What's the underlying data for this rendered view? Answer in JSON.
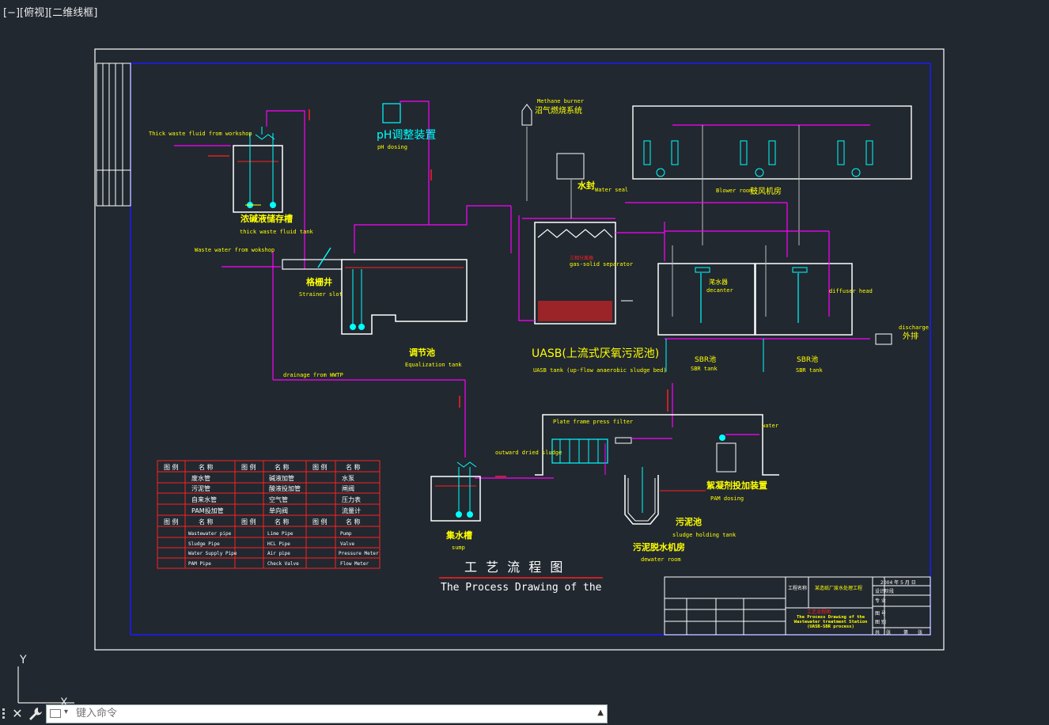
{
  "viewport": {
    "label": "[−][俯视][二维线框]"
  },
  "colors": {
    "background": "#212830",
    "frame": "#ffffff",
    "border": "#1a1aff",
    "pipe": "#ff00ff",
    "red": "#ff2020",
    "cyan": "#00ffff",
    "yellow": "#ffff00",
    "green": "#00ff00",
    "grey": "#bdbdbd"
  },
  "drawing": {
    "labels": {
      "thick_fluid_from_workshop": "Thick waste fluid from workshop",
      "thick_tank_cn": "浓碱液储存槽",
      "thick_tank_en": "thick waste fluid tank",
      "waste_water_from_workshop": "Waste water from wokshop",
      "strainer_cn": "格栅井",
      "strainer_en": "Strainer slot",
      "ph_cn": "pH调整装置",
      "ph_en": "pH dosing",
      "methane_en": "Methane burner",
      "methane_cn": "沼气燃烧系统",
      "water_seal_cn": "水封",
      "water_seal_en": "Water seal",
      "gas_solid_cn": "三相分离器",
      "gas_solid_en": "gas-solid separator",
      "blower_en": "Blower room",
      "blower_cn": "鼓风机房",
      "decanter_cn": "滗水器",
      "decanter_en": "decanter",
      "diffuser_en": "diffuser head",
      "discharge_en": "discharge",
      "discharge_cn": "外排",
      "equalization_cn": "调节池",
      "equalization_en": "Equalization tank",
      "uasb_cn": "UASB(上流式厌氧污泥池)",
      "uasb_en": "UASB tank (up-flow anaerobic sludge bed)",
      "sbr1_cn": "SBR池",
      "sbr1_en": "SBR tank",
      "sbr2_cn": "SBR池",
      "sbr2_en": "SBR tank",
      "drainage_en": "drainage from WWTP",
      "plate_frame_en": "Plate frame press filter",
      "outward_sludge_en": "outward dried sludge",
      "water_en": "water",
      "pam_cn": "絮凝剂投加装置",
      "pam_en": "PAM dosing",
      "sludge_tank_cn": "污泥池",
      "sludge_tank_en": "sludge holding tank",
      "dewater_cn": "污泥脱水机房",
      "dewater_en": "dewater room",
      "sump_cn": "集水槽",
      "sump_en": "sump",
      "title_cn": "工 艺 流 程 图",
      "title_en": "The Process Drawing of the"
    },
    "legend": {
      "header_cn": [
        "图 例",
        "名 称",
        "图 例",
        "名 称",
        "图 例",
        "名 称"
      ],
      "rows_cn": [
        [
          "废水管",
          "碱液加管",
          "水泵"
        ],
        [
          "污泥管",
          "酸液投加管",
          "闸阀"
        ],
        [
          "自来水管",
          "空气管",
          "压力表"
        ],
        [
          "PAM投加管",
          "单向阀",
          "流量计"
        ]
      ],
      "rows_en": [
        [
          "Wastewater pipe",
          "Lime Pipe",
          "Pump"
        ],
        [
          "Sludge Pipe",
          "HCL Pipe",
          "Valve"
        ],
        [
          "Water Supply Pipe",
          "Air pipe",
          "Pressure Meter"
        ],
        [
          "PAM Pipe",
          "Check Valve",
          "Flow Meter"
        ]
      ]
    },
    "titleblock": {
      "project_label": "工程名称",
      "project_name": "某造纸厂废水处理工程",
      "date": "2004 年 5 月  日",
      "design_phase": "设计阶段",
      "drawing_name_cn": "工艺流程图",
      "drawing_name_en": "The Process Drawing of the Wastewater treatment Station (UASB-SBR process)",
      "rows": [
        "专 业",
        "图 号",
        "图 别"
      ],
      "footer": [
        "共",
        "张",
        "第",
        "张"
      ]
    }
  },
  "command": {
    "close_icon": "close-icon",
    "wrench_icon": "wrench-icon",
    "placeholder": "键入命令"
  },
  "ucs": {
    "y": "Y",
    "x": "X"
  }
}
